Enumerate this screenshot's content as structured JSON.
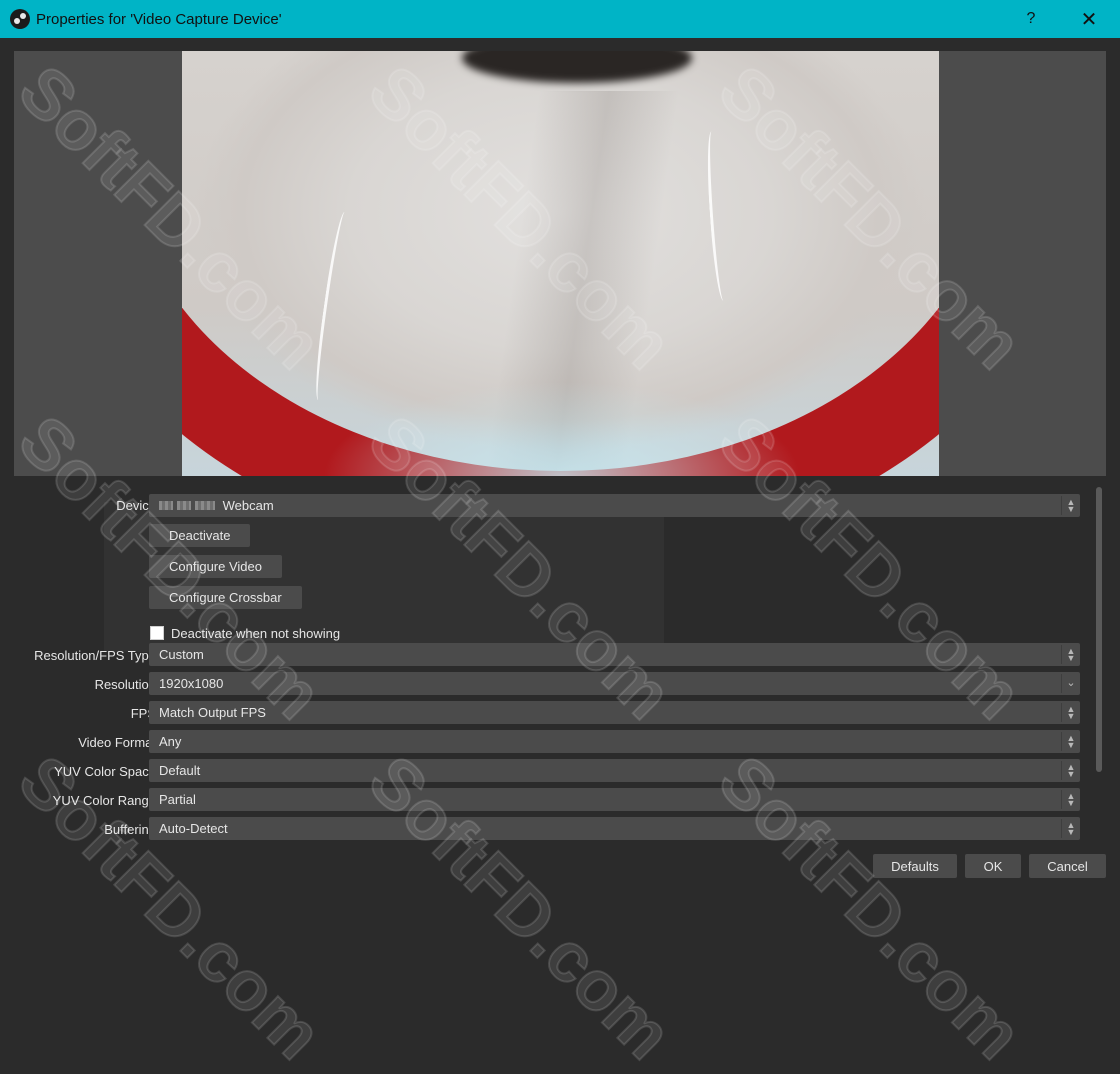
{
  "window": {
    "title": "Properties for 'Video Capture Device'",
    "help_label": "?",
    "close_label": "✕"
  },
  "watermark": "SoftFD.com",
  "form": {
    "device": {
      "label": "Device",
      "value": "Webcam"
    },
    "deactivate_label": "Deactivate",
    "configure_video_label": "Configure Video",
    "configure_crossbar_label": "Configure Crossbar",
    "deactivate_when_not_showing": {
      "label": "Deactivate when not showing",
      "checked": false
    },
    "resolution_fps_type": {
      "label": "Resolution/FPS Type",
      "value": "Custom"
    },
    "resolution": {
      "label": "Resolution",
      "value": "1920x1080"
    },
    "fps": {
      "label": "FPS",
      "value": "Match Output FPS"
    },
    "video_format": {
      "label": "Video Format",
      "value": "Any"
    },
    "yuv_color_space": {
      "label": "YUV Color Space",
      "value": "Default"
    },
    "yuv_color_range": {
      "label": "YUV Color Range",
      "value": "Partial"
    },
    "buffering": {
      "label": "Buffering",
      "value": "Auto-Detect"
    }
  },
  "footer": {
    "defaults_label": "Defaults",
    "ok_label": "OK",
    "cancel_label": "Cancel"
  },
  "colors": {
    "titlebar": "#00b4c6",
    "background": "#2b2b2b",
    "control": "#4b4b4b"
  }
}
